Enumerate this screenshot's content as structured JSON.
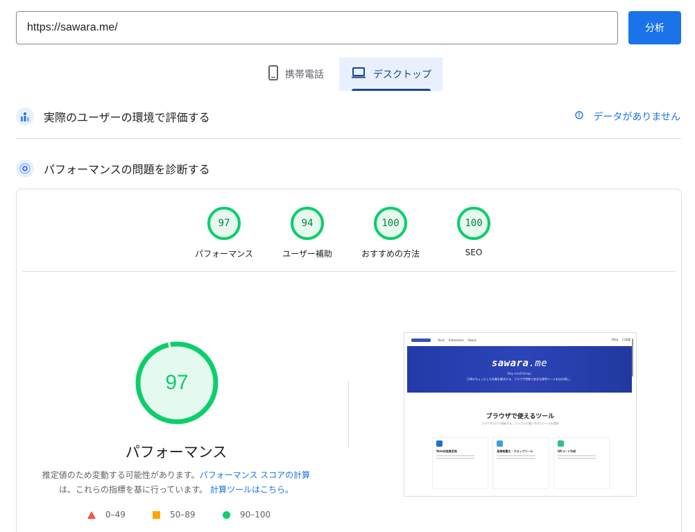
{
  "url": {
    "value": "https://sawara.me/"
  },
  "analyze_label": "分析",
  "tabs": [
    {
      "label": "携帯電話",
      "icon": "smartphone-icon",
      "selected": false
    },
    {
      "label": "デスクトップ",
      "icon": "laptop-icon",
      "selected": true
    }
  ],
  "field_section": {
    "title": "実際のユーザーの環境で評価する",
    "status": "データがありません",
    "status_icon": "info-icon"
  },
  "diagnose_section": {
    "title": "パフォーマンスの問題を診断する"
  },
  "scores": [
    {
      "value": "97",
      "label": "パフォーマンス"
    },
    {
      "value": "94",
      "label": "ユーザー補助"
    },
    {
      "value": "100",
      "label": "おすすめの方法"
    },
    {
      "value": "100",
      "label": "SEO"
    }
  ],
  "main_score": {
    "value": "97",
    "title": "パフォーマンス",
    "desc_before": "推定値のため変動する可能性があります。",
    "desc_link1": "パフォーマンス スコアの計算",
    "desc_middle": "は、これらの指標を基に行っています。",
    "desc_link2": "計算ツールはこちら。"
  },
  "legend": [
    {
      "range": "0–49",
      "color": "#ff4e42",
      "shape": "triangle"
    },
    {
      "range": "50–89",
      "color": "#ffa400",
      "shape": "square"
    },
    {
      "range": "90–100",
      "color": "#0cce6b",
      "shape": "circle"
    }
  ],
  "colors": {
    "accent": "#1a73e8",
    "pass": "#0cce6b"
  },
  "thumbnail": {
    "nav_links": [
      "Tools",
      "Extensions",
      "About"
    ],
    "nav_right": [
      "Blog",
      "日本語"
    ],
    "brand_prefix": "sawara",
    "brand_suffix": ".me",
    "tagline": "Stay small things.",
    "hero_desc": "日常のちょっとした作業を解決する、ブラウザ完結で安全な便利ツールを自分用に。",
    "section_title": "ブラウザで使えるツール",
    "section_sub": "ブラウザだけで完結する、シンプルで使いやすいツールを提供",
    "cards": [
      {
        "title": "Web的画像変換",
        "color": "#1e6fd0"
      },
      {
        "title": "画像軽量化・クロップツール",
        "color": "#3aa0e0"
      },
      {
        "title": "QRコード作成",
        "color": "#2fbf8f"
      }
    ]
  }
}
